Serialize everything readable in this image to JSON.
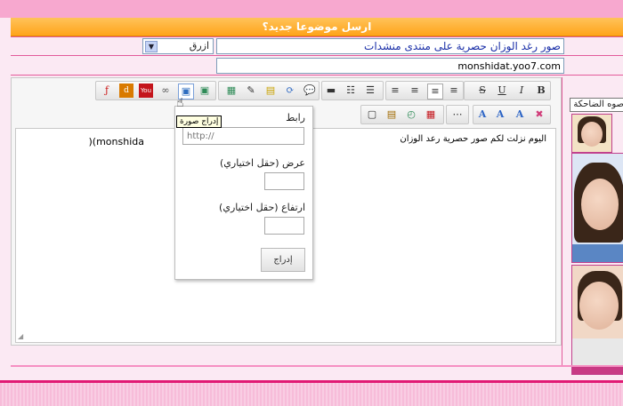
{
  "header": {
    "title": "ارسل موضوعا جديد؟"
  },
  "form": {
    "subject_value": "صور رغد الوزان حصرية على منتدى منشدات",
    "color_select_value": "ازرق",
    "url_value": "monshidat.yoo7.com"
  },
  "toolbar": {
    "row1": [
      "B",
      "I",
      "U",
      "S",
      "align-justify",
      "align-center",
      "align-right",
      "align-left",
      "numbered-list",
      "bulleted-list",
      "horizontal-rule",
      "speech",
      "refresh",
      "note",
      "edit",
      "insert-table",
      "insert-image",
      "insert-image-alt",
      "link",
      "youtube",
      "dailymotion",
      "flash"
    ],
    "row2": [
      "clear-format",
      "font-color",
      "font-size",
      "font-family",
      "more",
      "date",
      "time",
      "paste",
      "copy"
    ]
  },
  "editor": {
    "text": "اليوم نزلت لكم صور حصرية رعد الوزان",
    "text_latin": "(monshida"
  },
  "popup": {
    "link_label": "رابط",
    "link_placeholder": "http://",
    "width_label": "عرض (حقل اختياري)",
    "height_label": "ارتفاع (حقل اختياري)",
    "insert_button": "إدراج"
  },
  "tooltip": {
    "text": "إدراج صورة"
  },
  "sidebar": {
    "title": "صوه الضاحكة"
  },
  "colors": {
    "accent": "#e11a74",
    "header": "#ffa41a",
    "background": "#fbe9f3"
  }
}
